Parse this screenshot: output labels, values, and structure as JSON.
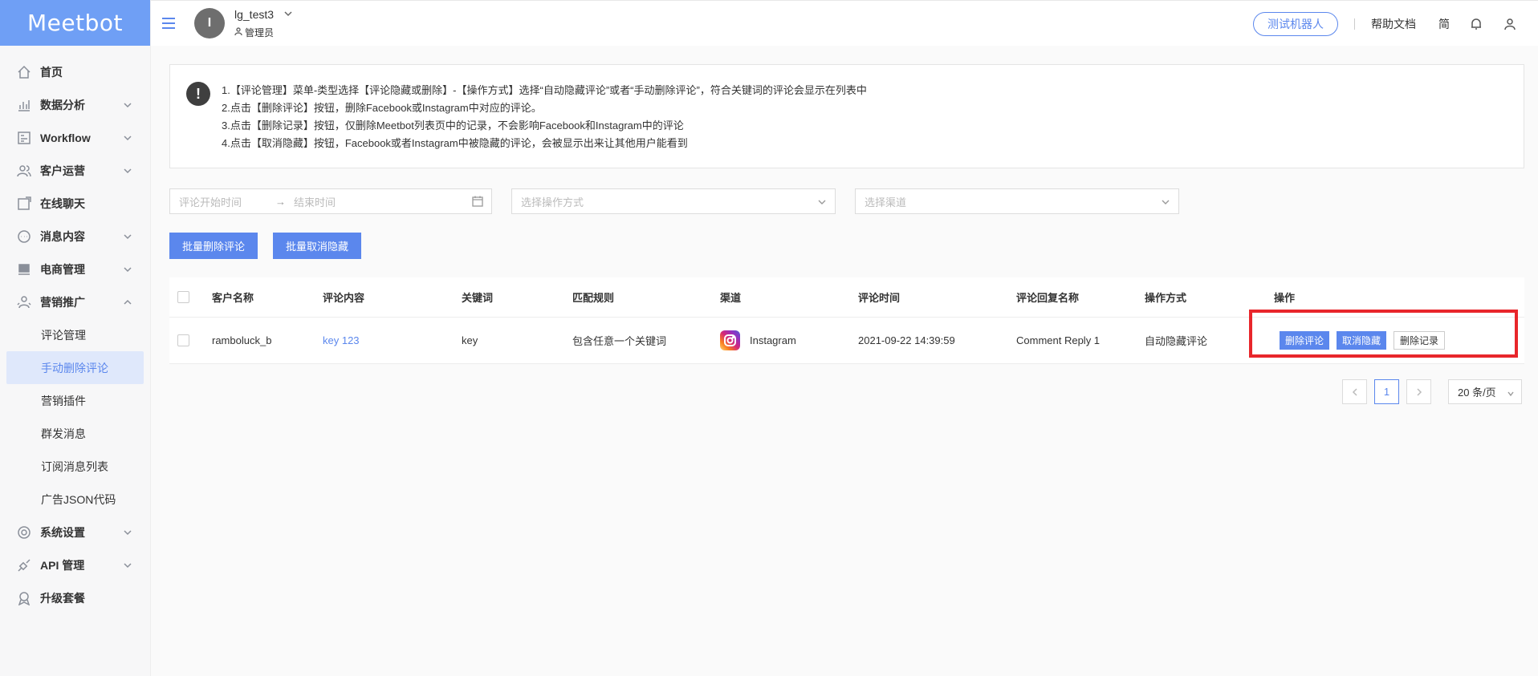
{
  "app": {
    "logo_text": "Meetbot"
  },
  "header": {
    "user_initial": "I",
    "user_name": "lg_test3",
    "user_role": "管理员",
    "test_bot": "测试机器人",
    "help_docs": "帮助文档",
    "lang": "简"
  },
  "sidebar": {
    "items": [
      {
        "label": "首页",
        "icon": "home-icon",
        "expandable": false
      },
      {
        "label": "数据分析",
        "icon": "chart-icon",
        "expandable": true
      },
      {
        "label": "Workflow",
        "icon": "workflow-icon",
        "expandable": true
      },
      {
        "label": "客户运营",
        "icon": "users-icon",
        "expandable": true
      },
      {
        "label": "在线聊天",
        "icon": "chat-icon",
        "expandable": false
      },
      {
        "label": "消息内容",
        "icon": "message-icon",
        "expandable": true
      },
      {
        "label": "电商管理",
        "icon": "shop-icon",
        "expandable": true
      },
      {
        "label": "营销推广",
        "icon": "marketing-icon",
        "expandable": true,
        "expanded": true
      }
    ],
    "sub_items": [
      {
        "label": "评论管理",
        "active": false
      },
      {
        "label": "手动删除评论",
        "active": true
      },
      {
        "label": "营销插件",
        "active": false
      },
      {
        "label": "群发消息",
        "active": false
      },
      {
        "label": "订阅消息列表",
        "active": false
      },
      {
        "label": "广告JSON代码",
        "active": false
      }
    ],
    "bottom_items": [
      {
        "label": "系统设置",
        "icon": "settings-icon",
        "expandable": true
      },
      {
        "label": "API 管理",
        "icon": "api-icon",
        "expandable": true
      },
      {
        "label": "升级套餐",
        "icon": "upgrade-icon",
        "expandable": false
      }
    ]
  },
  "notice": {
    "lines": [
      "1.【评论管理】菜单-类型选择【评论隐藏或删除】-【操作方式】选择“自动隐藏评论”或者“手动删除评论”，符合关键词的评论会显示在列表中",
      "2.点击【删除评论】按钮，删除Facebook或Instagram中对应的评论。",
      "3.点击【删除记录】按钮，仅删除Meetbot列表页中的记录，不会影响Facebook和Instagram中的评论",
      "4.点击【取消隐藏】按钮，Facebook或者Instagram中被隐藏的评论，会被显示出来让其他用户能看到"
    ]
  },
  "filters": {
    "start_placeholder": "评论开始时间",
    "arrow": "→",
    "end_placeholder": "结束时间",
    "operation_placeholder": "选择操作方式",
    "channel_placeholder": "选择渠道"
  },
  "actions": {
    "batch_delete": "批量删除评论",
    "batch_unhide": "批量取消隐藏"
  },
  "table": {
    "headers": [
      "客户名称",
      "评论内容",
      "关键词",
      "匹配规则",
      "渠道",
      "评论时间",
      "评论回复名称",
      "操作方式",
      "操作"
    ],
    "rows": [
      {
        "customer": "ramboluck_b",
        "content": "key 123",
        "keyword": "key",
        "rule": "包含任意一个关键词",
        "channel": "Instagram",
        "time": "2021-09-22 14:39:59",
        "reply_name": "Comment Reply 1",
        "mode": "自动隐藏评论",
        "ops": {
          "delete_comment": "删除评论",
          "unhide": "取消隐藏",
          "delete_record": "删除记录"
        }
      }
    ]
  },
  "pagination": {
    "current_page": "1",
    "page_size": "20 条/页"
  },
  "colors": {
    "accent": "#5b87ed",
    "logo_bg": "#6f9ff5",
    "highlight": "#e8262b"
  }
}
